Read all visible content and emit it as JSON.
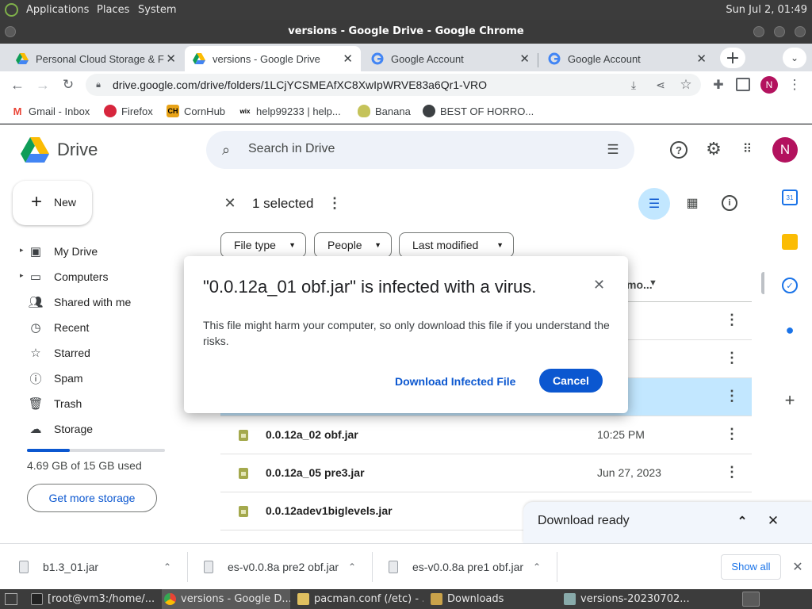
{
  "os_panel": {
    "menus": [
      "Applications",
      "Places",
      "System"
    ],
    "clock": "Sun Jul 2, 01:49"
  },
  "window": {
    "title": "versions - Google Drive - Google Chrome"
  },
  "tabs": [
    {
      "label": "Personal Cloud Storage & F",
      "icon": "google-drive-icon",
      "active": false
    },
    {
      "label": "versions - Google Drive",
      "icon": "google-drive-icon",
      "active": true
    },
    {
      "label": "Google Account",
      "icon": "google-g-icon",
      "active": false
    },
    {
      "label": "Google Account",
      "icon": "google-g-icon",
      "active": false
    }
  ],
  "address_bar": {
    "url": "drive.google.com/drive/folders/1LCjYCSMEAfXC8XwIpWRVE83a6Qr1-VRO"
  },
  "profile_initial": "N",
  "bookmarks": [
    {
      "label": "Gmail - Inbox",
      "icon": "gmail-icon"
    },
    {
      "label": "Firefox",
      "icon": "firefox-icon"
    },
    {
      "label": "CornHub",
      "icon": "ch-icon"
    },
    {
      "label": "help99233 | help...",
      "icon": "wix-icon"
    },
    {
      "label": "Banana",
      "icon": "banana-icon"
    },
    {
      "label": "BEST OF HORRO...",
      "icon": "globe-icon"
    }
  ],
  "drive": {
    "logo_text": "Drive",
    "search_placeholder": "Search in Drive",
    "new_label": "New",
    "nav": [
      {
        "label": "My Drive",
        "icon": "my-drive-icon"
      },
      {
        "label": "Computers",
        "icon": "computers-icon"
      },
      {
        "label": "Shared with me",
        "icon": "shared-icon"
      },
      {
        "label": "Recent",
        "icon": "clock-icon"
      },
      {
        "label": "Starred",
        "icon": "star-icon"
      },
      {
        "label": "Spam",
        "icon": "spam-icon"
      },
      {
        "label": "Trash",
        "icon": "trash-icon"
      },
      {
        "label": "Storage",
        "icon": "cloud-icon"
      }
    ],
    "storage_text": "4.69 GB of 15 GB used",
    "storage_fraction": 0.31,
    "get_storage_label": "Get more storage",
    "selection_text": "1 selected",
    "filters": [
      "File type",
      "People",
      "Last modified"
    ],
    "column_header_partial": "mo...",
    "rows": [
      {
        "name": "",
        "date": "PM",
        "selected": false
      },
      {
        "name": "",
        "date": "PM",
        "selected": false
      },
      {
        "name": "",
        "date": "PM",
        "selected": true
      },
      {
        "name": "0.0.12a_02 obf.jar",
        "date": "10:25 PM",
        "selected": false
      },
      {
        "name": "0.0.12a_05 pre3.jar",
        "date": "Jun 27, 2023",
        "selected": false
      },
      {
        "name": "0.0.12adev1biglevels.jar",
        "date": "",
        "selected": false
      }
    ],
    "download_ready": "Download ready"
  },
  "dialog": {
    "title": "\"0.0.12a_01 obf.jar\" is infected with a virus.",
    "body": "This file might harm your computer, so only download this file if you understand the risks.",
    "download_label": "Download Infected File",
    "cancel_label": "Cancel"
  },
  "download_shelf": {
    "items": [
      "b1.3_01.jar",
      "es-v0.0.8a pre2 obf.jar",
      "es-v0.0.8a pre1 obf.jar"
    ],
    "show_all": "Show all"
  },
  "taskbar": [
    {
      "label": "[root@vm3:/home/...",
      "active": false
    },
    {
      "label": "versions - Google D...",
      "active": true
    },
    {
      "label": "pacman.conf (/etc) - ...",
      "active": false
    },
    {
      "label": "Downloads",
      "active": false
    },
    {
      "label": "versions-20230702...",
      "active": false
    }
  ],
  "colors": {
    "accent": "#0b57d0",
    "selected_row": "#c2e7ff",
    "avatar": "#b3125e"
  }
}
